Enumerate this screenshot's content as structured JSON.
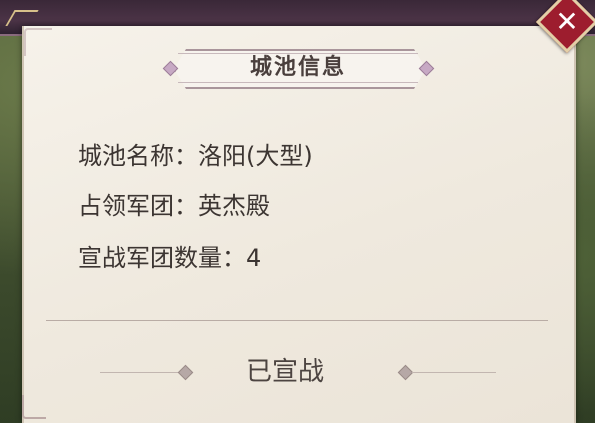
{
  "dialog": {
    "title": "城池信息",
    "close_icon": "close-x-icon",
    "info_rows": [
      {
        "label": "城池名称",
        "sep": "：",
        "value": "洛阳(大型)"
      },
      {
        "label": "占领军团",
        "sep": "：",
        "value": "英杰殿"
      },
      {
        "label": "宣战军团数量",
        "sep": "：",
        "value": "4"
      }
    ],
    "status": "已宣战"
  },
  "colors": {
    "panel": "#f3eee5",
    "text": "#3c3532",
    "close_button": "#9d1d2e",
    "header_band": "#3a2838"
  }
}
